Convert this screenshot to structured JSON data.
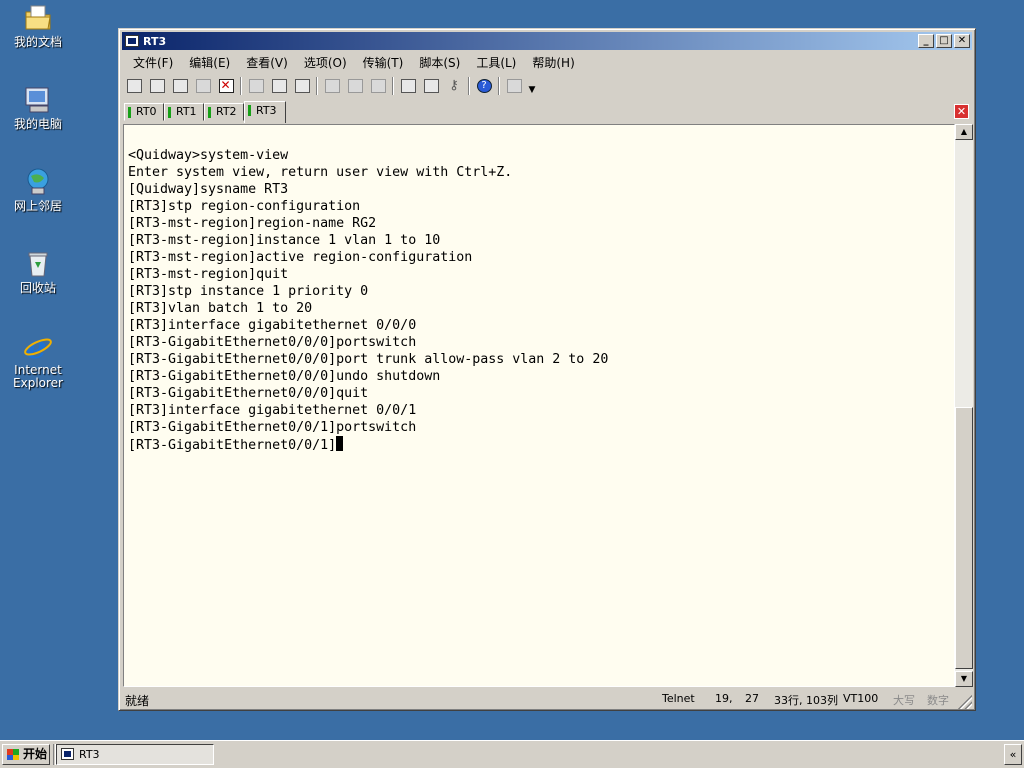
{
  "desktop": {
    "icons": [
      {
        "label": "我的文档",
        "icon": "my-documents-icon"
      },
      {
        "label": "我的电脑",
        "icon": "my-computer-icon"
      },
      {
        "label": "网上邻居",
        "icon": "network-places-icon"
      },
      {
        "label": "回收站",
        "icon": "recycle-bin-icon"
      },
      {
        "label": "Internet\nExplorer",
        "icon": "internet-explorer-icon"
      }
    ]
  },
  "window": {
    "title": "RT3",
    "title_buttons": {
      "minimize": "_",
      "maximize": "□",
      "close": "✕"
    }
  },
  "menu": [
    {
      "label": "文件(F)"
    },
    {
      "label": "编辑(E)"
    },
    {
      "label": "查看(V)"
    },
    {
      "label": "选项(O)"
    },
    {
      "label": "传输(T)"
    },
    {
      "label": "脚本(S)"
    },
    {
      "label": "工具(L)"
    },
    {
      "label": "帮助(H)"
    }
  ],
  "tabs": [
    {
      "label": "RT0",
      "active": false
    },
    {
      "label": "RT1",
      "active": false
    },
    {
      "label": "RT2",
      "active": false
    },
    {
      "label": "RT3",
      "active": true
    }
  ],
  "terminal": {
    "lines": [
      "<Quidway>system-view",
      "Enter system view, return user view with Ctrl+Z.",
      "[Quidway]sysname RT3",
      "[RT3]stp region-configuration",
      "[RT3-mst-region]region-name RG2",
      "[RT3-mst-region]instance 1 vlan 1 to 10",
      "[RT3-mst-region]active region-configuration",
      "[RT3-mst-region]quit",
      "[RT3]stp instance 1 priority 0",
      "[RT3]vlan batch 1 to 20",
      "[RT3]interface gigabitethernet 0/0/0",
      "[RT3-GigabitEthernet0/0/0]portswitch",
      "[RT3-GigabitEthernet0/0/0]port trunk allow-pass vlan 2 to 20",
      "[RT3-GigabitEthernet0/0/0]undo shutdown",
      "[RT3-GigabitEthernet0/0/0]quit",
      "[RT3]interface gigabitethernet 0/0/1",
      "[RT3-GigabitEthernet0/0/1]portswitch"
    ],
    "prompt": "[RT3-GigabitEthernet0/0/1]"
  },
  "statusbar": {
    "ready": "就绪",
    "protocol": "Telnet",
    "row": "19,",
    "col": "27",
    "size": "33行, 103列",
    "emulation": "VT100",
    "caps": "大写",
    "num": "数字"
  },
  "taskbar": {
    "start": "开始",
    "task": "RT3",
    "tray": "«"
  }
}
